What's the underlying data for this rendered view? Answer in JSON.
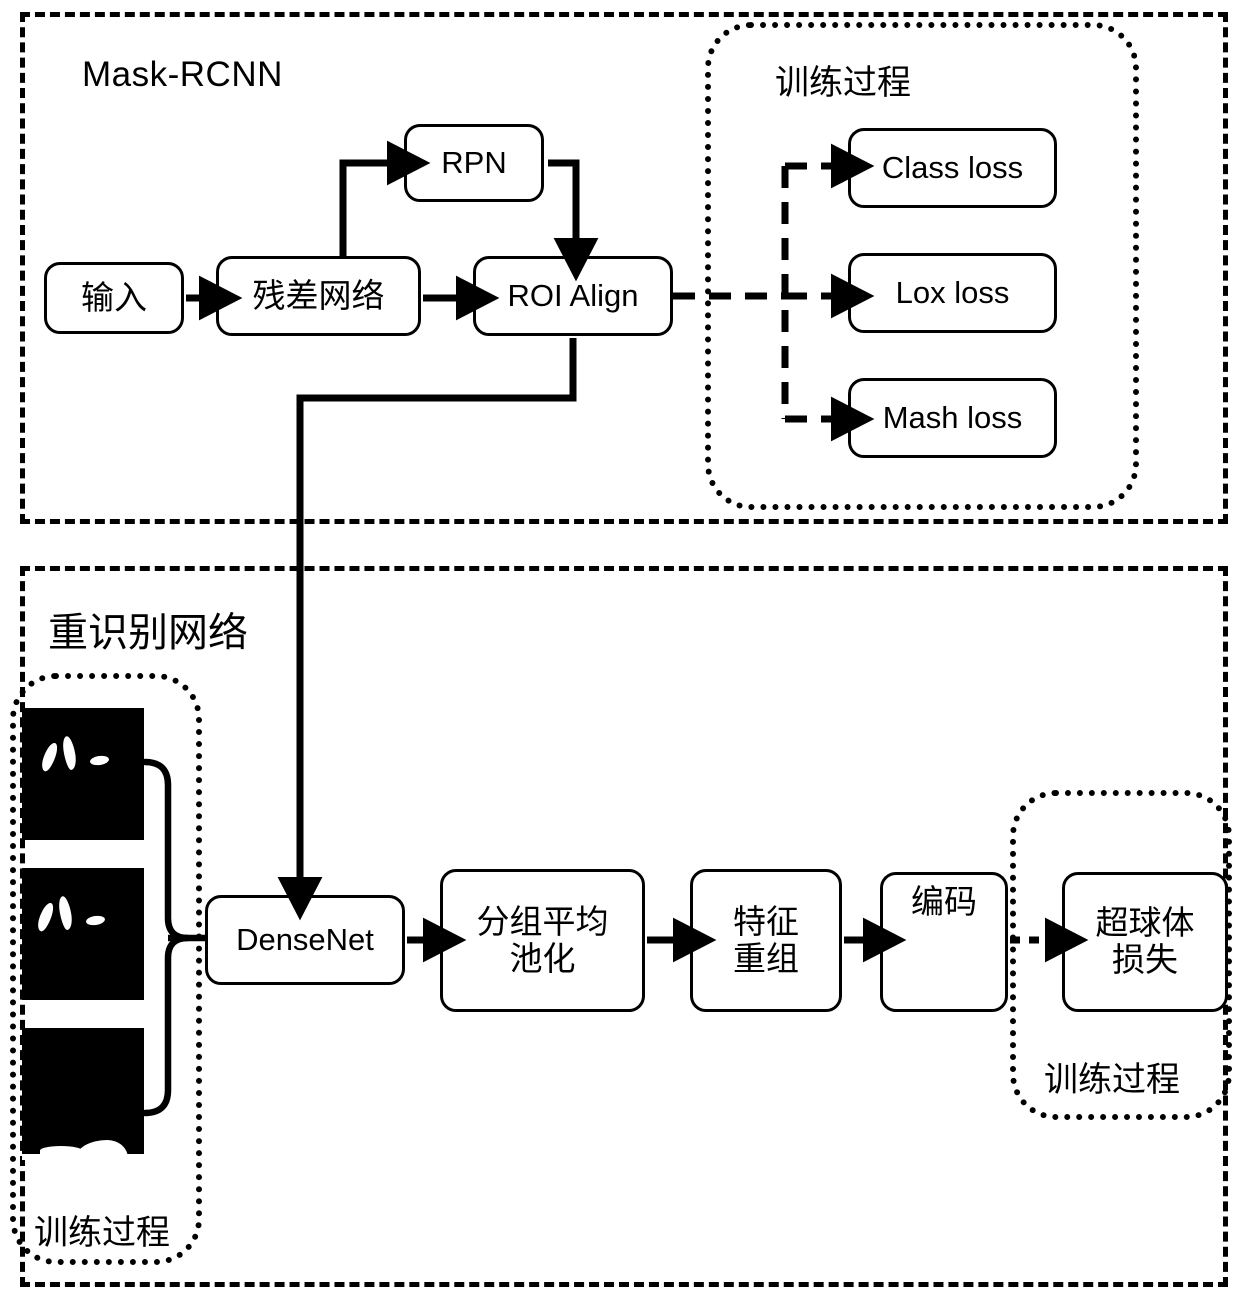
{
  "figure": {
    "type": "diagram",
    "subtype": "network-architecture-flowchart",
    "background": "#ffffff",
    "stroke_color": "#000000"
  },
  "regions": {
    "mask_rcnn": {
      "label": "Mask-RCNN",
      "border_style": "dashed"
    },
    "mask_rcnn_training": {
      "label": "训练过程",
      "border_style": "dotted"
    },
    "reid": {
      "label": "重识别网络",
      "border_style": "dashed"
    },
    "reid_samples_training": {
      "label": "训练过程",
      "border_style": "dotted"
    },
    "reid_loss_training": {
      "label": "训练过程",
      "border_style": "dotted"
    }
  },
  "nodes": {
    "input": {
      "label": "输入",
      "script": "cjk"
    },
    "backbone": {
      "label": "残差网络",
      "script": "cjk"
    },
    "rpn": {
      "label": "RPN",
      "script": "latin"
    },
    "roi_align": {
      "label": "ROI Align",
      "script": "latin"
    },
    "class_loss": {
      "label": "Class loss",
      "script": "latin"
    },
    "lox_loss": {
      "label": "Lox loss",
      "script": "latin"
    },
    "mash_loss": {
      "label": "Mash loss",
      "script": "latin"
    },
    "densenet": {
      "label": "DenseNet",
      "script": "latin"
    },
    "group_avg_pool": {
      "label": "分组平均\n池化",
      "line1": "分组平均",
      "line2": "池化",
      "script": "cjk"
    },
    "feature_regroup": {
      "label": "特征\n重组",
      "line1": "特征",
      "line2": "重组",
      "script": "cjk"
    },
    "encode": {
      "label": "编码",
      "script": "cjk"
    },
    "hypersphere_loss": {
      "label": "超球体\n损失",
      "line1": "超球体",
      "line2": "损失",
      "script": "cjk"
    }
  },
  "samples": [
    {
      "name": "mask-sample-1",
      "description": "binary mask thumbnail with white blobs"
    },
    {
      "name": "mask-sample-2",
      "description": "binary mask thumbnail with white blobs"
    },
    {
      "name": "mask-sample-3",
      "description": "binary mask thumbnail with white ground strip"
    }
  ],
  "edges": [
    {
      "from": "input",
      "to": "backbone",
      "style": "solid"
    },
    {
      "from": "backbone",
      "to": "rpn",
      "style": "solid"
    },
    {
      "from": "backbone",
      "to": "roi_align",
      "style": "solid"
    },
    {
      "from": "rpn",
      "to": "roi_align",
      "style": "solid"
    },
    {
      "from": "roi_align",
      "to": "class_loss",
      "style": "dashed"
    },
    {
      "from": "roi_align",
      "to": "lox_loss",
      "style": "dashed"
    },
    {
      "from": "roi_align",
      "to": "mash_loss",
      "style": "dashed"
    },
    {
      "from": "roi_align",
      "to": "densenet",
      "style": "solid"
    },
    {
      "from": "samples",
      "to": "densenet",
      "style": "solid"
    },
    {
      "from": "densenet",
      "to": "group_avg_pool",
      "style": "solid"
    },
    {
      "from": "group_avg_pool",
      "to": "feature_regroup",
      "style": "solid"
    },
    {
      "from": "feature_regroup",
      "to": "encode",
      "style": "solid"
    },
    {
      "from": "encode",
      "to": "hypersphere_loss",
      "style": "dashed"
    }
  ]
}
